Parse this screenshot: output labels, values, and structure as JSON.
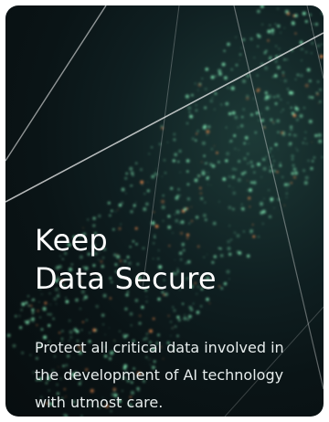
{
  "card": {
    "title_line1": "Keep",
    "title_line2": "Data Secure",
    "description_line1": "Protect all critical data involved in",
    "description_line2": "the development of AI technology",
    "description_line3": "with utmost care."
  },
  "colors": {
    "background_dark": "#0a1416",
    "background_teal": "#1d3a37",
    "title_text": "#ffffff",
    "body_text": "#e6ecec",
    "particle_green": "#7fe3b0",
    "particle_orange": "#e98a4f"
  },
  "icons": [
    "data-particle-background"
  ]
}
